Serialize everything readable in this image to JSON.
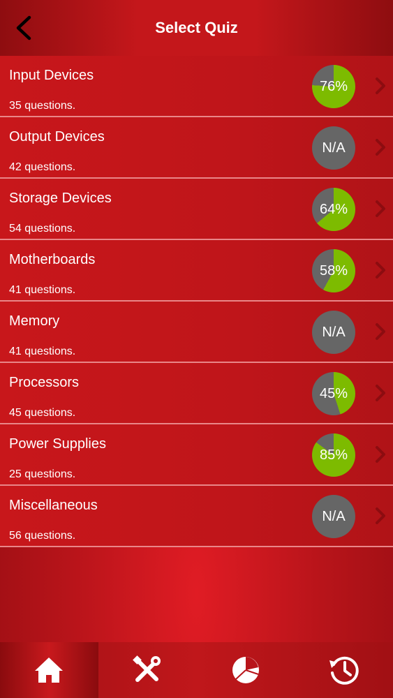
{
  "header": {
    "title": "Select Quiz",
    "back_icon": "chevron-left-icon"
  },
  "colors": {
    "background": "#c4171b",
    "progress_green": "#7dbb00",
    "progress_gray": "#666666",
    "divider": "#e98688"
  },
  "quizzes": [
    {
      "name": "Input Devices",
      "count": "35 questions.",
      "score": "76%",
      "progress": 76
    },
    {
      "name": "Output Devices",
      "count": "42 questions.",
      "score": "N/A",
      "progress": null
    },
    {
      "name": "Storage Devices",
      "count": "54 questions.",
      "score": "64%",
      "progress": 64
    },
    {
      "name": "Motherboards",
      "count": "41 questions.",
      "score": "58%",
      "progress": 58
    },
    {
      "name": "Memory",
      "count": "41 questions.",
      "score": "N/A",
      "progress": null
    },
    {
      "name": "Processors",
      "count": "45 questions.",
      "score": "45%",
      "progress": 45
    },
    {
      "name": "Power Supplies",
      "count": "25 questions.",
      "score": "85%",
      "progress": 85
    },
    {
      "name": "Miscellaneous",
      "count": "56 questions.",
      "score": "N/A",
      "progress": null
    }
  ],
  "tabs": [
    {
      "icon": "home-icon",
      "active": true
    },
    {
      "icon": "tools-icon",
      "active": false
    },
    {
      "icon": "pie-chart-icon",
      "active": false
    },
    {
      "icon": "history-icon",
      "active": false
    }
  ]
}
